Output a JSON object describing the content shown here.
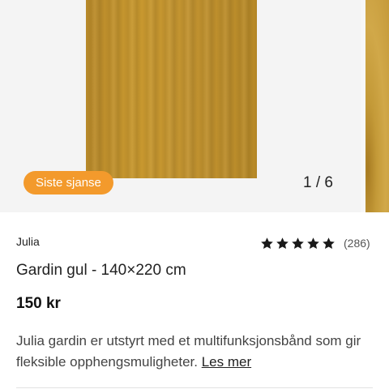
{
  "gallery": {
    "badge": "Siste sjanse",
    "counter": "1 / 6"
  },
  "product": {
    "brand": "Julia",
    "rating_stars": 5,
    "review_count": "(286)",
    "title": "Gardin gul - 140×220 cm",
    "price": "150 kr",
    "description": "Julia gardin er utstyrt med et multifunksjonsbånd som gir fleksible opphengsmuligheter.",
    "read_more": "Les mer"
  },
  "colors": {
    "badge": "#f39a2c",
    "curtain": "#c4952f",
    "star": "#1a1a1a"
  }
}
